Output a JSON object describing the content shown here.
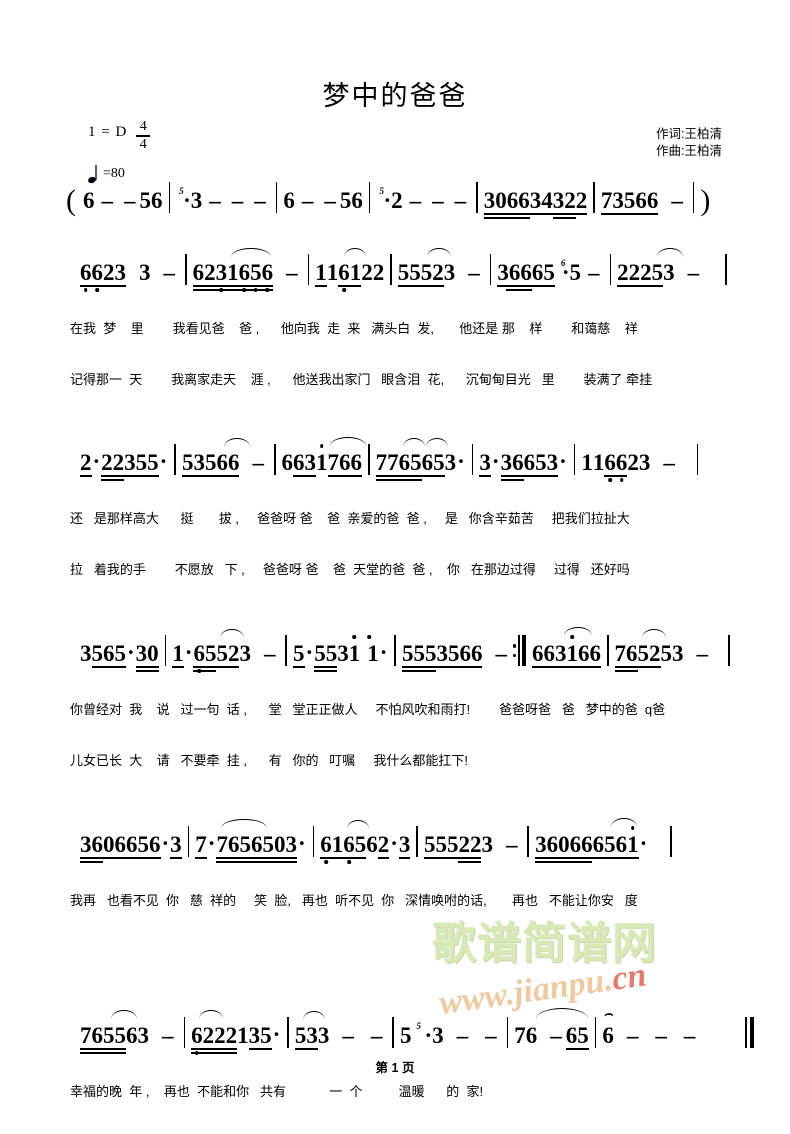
{
  "title": "梦中的爸爸",
  "credits": {
    "lyricist": "作词:王柏清",
    "composer": "作曲:王柏清"
  },
  "key": {
    "label": "1 = D",
    "time_top": "4",
    "time_bottom": "4",
    "tempo": "=80"
  },
  "intro": {
    "open_paren": "(",
    "close_paren": ")",
    "measures": [
      "6 -  -56",
      "3 - - -",
      "6 -  -56",
      "2 - - -",
      "30663432 2",
      "73566 -"
    ]
  },
  "systems": [
    {
      "measures": [
        "6623  3 -",
        "6231656 -",
        "116122",
        "55523 -",
        "36665 5 -",
        "22253 -"
      ],
      "lyrics": [
        "在我  梦    里        我看见爸    爸 ,      他向我  走  来   满头白  发,       他还是 那    样        和蔼慈    祥",
        "记得那一  天        我离家走天    涯 ,      他送我出家门   眼含泪  花,      沉甸甸目光   里        装满了 牵挂"
      ]
    },
    {
      "measures": [
        "2·22355·",
        "53566 -",
        "6631766",
        "7765653·",
        "3·36653·",
        "116623 -"
      ],
      "lyrics": [
        "还   是那样高大      挺       拔 ,     爸爸呀 爸    爸  亲爱的爸  爸 ,     是   你含辛茹苦     把我们拉扯大",
        "拉   着我的手        不愿放   下 ,     爸爸呀 爸    爸  天堂的爸  爸 ,    你   在那边过得     过得   还好吗"
      ]
    },
    {
      "measures": [
        "3565·30",
        "1·65523 -",
        "5·553 1 1 ·",
        "5553566 -",
        "663166",
        "765253 -"
      ],
      "lyrics": [
        "你曾经对  我    说   过一句  话 ,      堂   堂正正做人     不怕风吹和雨打!        爸爸呀爸   爸   梦中的爸  q爸",
        "儿女已长  大    请   不要牵  挂 ,      有   你的   叮嘱     我什么都能扛下!"
      ]
    },
    {
      "measures": [
        "3606656·3",
        "7·7656503·",
        "616562·3",
        "555223 -",
        "3606666561·"
      ],
      "lyrics": [
        "我再   也看不见  你   慈  祥的     笑  脸,   再也  听不见  你   深情唤咐的话,       再也   不能让你安   度"
      ]
    },
    {
      "measures": [
        "765563 -",
        "6222135·",
        "533 - -",
        "5 3 - -",
        "76 -65",
        "6 - - -"
      ],
      "lyrics": [
        "幸福的晚  年 ,    再也  不能和你   共有            一  个          温暖      的  家!"
      ]
    }
  ],
  "watermark": {
    "cn": "歌谱简谱网",
    "url_www": "www.jianpu.",
    "url_dom": "cn"
  },
  "footer": "第 1 页"
}
